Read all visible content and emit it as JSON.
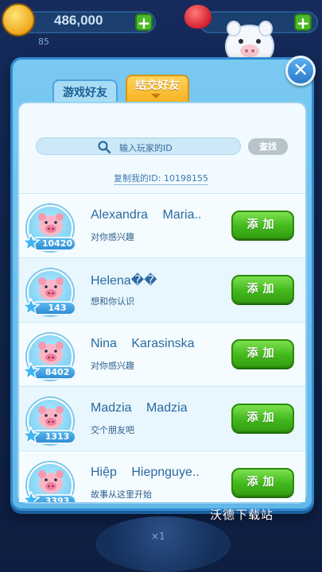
{
  "hud": {
    "coins": "486,000",
    "coin_plus": "+",
    "gem_plus": "+",
    "sub_value": "85"
  },
  "dialog": {
    "close_label": "✕",
    "tabs": [
      {
        "label": "游戏好友",
        "selected": false
      },
      {
        "label": "结交好友",
        "selected": true
      }
    ],
    "search": {
      "placeholder": "输入玩家的ID",
      "button_label": "查找"
    },
    "copy_id_label": "复制我的ID: 10198155",
    "players": [
      {
        "name": "Alexandra Maria..",
        "status": "对你感兴趣",
        "level": "10420",
        "button": "添加"
      },
      {
        "name": "Helena��",
        "status": "想和你认识",
        "level": "143",
        "button": "添加"
      },
      {
        "name": "Nina Karasinska",
        "status": "对你感兴趣",
        "level": "8402",
        "button": "添加"
      },
      {
        "name": "Madzia Madzia",
        "status": "交个朋友吧",
        "level": "1313",
        "button": "添加"
      },
      {
        "name": "Hiệp Hiepnguye..",
        "status": "故事从这里开始",
        "level": "3393",
        "button": "添加"
      }
    ]
  },
  "footer": {
    "watermark": "沃德下载站",
    "multiplier": "×1"
  },
  "colors": {
    "accent_green": "#43b91d",
    "tab_active": "#f7b11f",
    "dialog_blue": "#63b8ea"
  }
}
